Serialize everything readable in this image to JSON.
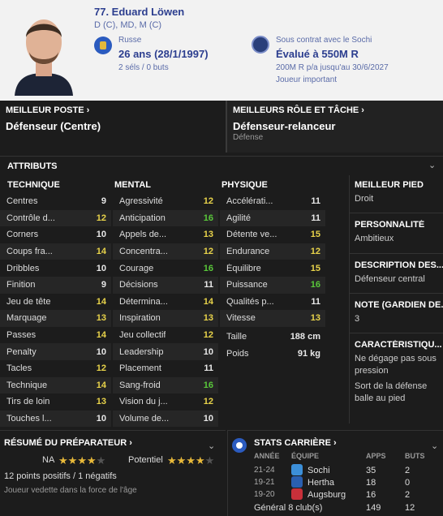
{
  "player": {
    "name": "77. Eduard Löwen",
    "positions": "D (C), MD, M (C)",
    "nationality": "Russe",
    "age": "26 ans (28/1/1997)",
    "caps": "2 séls / 0 buts",
    "contract": "Sous contrat avec le Sochi",
    "value": "Évalué à 550M R",
    "wage": "200M R p/a jusqu'au 30/6/2027",
    "status": "Joueur important"
  },
  "best_position": {
    "title": "MEILLEUR POSTE ›",
    "value": "Défenseur (Centre)"
  },
  "best_role": {
    "title": "MEILLEURS RÔLE ET TÂCHE ›",
    "value": "Défenseur-relanceur",
    "duty": "Défense"
  },
  "attributes": {
    "title": "ATTRIBUTS",
    "technique": {
      "header": "TECHNIQUE",
      "rows": [
        {
          "label": "Centres",
          "value": "9"
        },
        {
          "label": "Contrôle d...",
          "value": "12"
        },
        {
          "label": "Corners",
          "value": "10"
        },
        {
          "label": "Coups fra...",
          "value": "14"
        },
        {
          "label": "Dribbles",
          "value": "10"
        },
        {
          "label": "Finition",
          "value": "9"
        },
        {
          "label": "Jeu de tête",
          "value": "14"
        },
        {
          "label": "Marquage",
          "value": "13"
        },
        {
          "label": "Passes",
          "value": "14"
        },
        {
          "label": "Penalty",
          "value": "10"
        },
        {
          "label": "Tacles",
          "value": "12"
        },
        {
          "label": "Technique",
          "value": "14"
        },
        {
          "label": "Tirs de loin",
          "value": "13"
        },
        {
          "label": "Touches l...",
          "value": "10"
        }
      ]
    },
    "mental": {
      "header": "MENTAL",
      "rows": [
        {
          "label": "Agressivité",
          "value": "12"
        },
        {
          "label": "Anticipation",
          "value": "16"
        },
        {
          "label": "Appels de...",
          "value": "13"
        },
        {
          "label": "Concentra...",
          "value": "12"
        },
        {
          "label": "Courage",
          "value": "16"
        },
        {
          "label": "Décisions",
          "value": "11"
        },
        {
          "label": "Détermina...",
          "value": "14"
        },
        {
          "label": "Inspiration",
          "value": "13"
        },
        {
          "label": "Jeu collectif",
          "value": "12"
        },
        {
          "label": "Leadership",
          "value": "10"
        },
        {
          "label": "Placement",
          "value": "11"
        },
        {
          "label": "Sang-froid",
          "value": "16"
        },
        {
          "label": "Vision du j...",
          "value": "12"
        },
        {
          "label": "Volume de...",
          "value": "10"
        }
      ]
    },
    "physique": {
      "header": "PHYSIQUE",
      "rows": [
        {
          "label": "Accélérati...",
          "value": "11"
        },
        {
          "label": "Agilité",
          "value": "11"
        },
        {
          "label": "Détente ve...",
          "value": "15"
        },
        {
          "label": "Endurance",
          "value": "12"
        },
        {
          "label": "Équilibre",
          "value": "15"
        },
        {
          "label": "Puissance",
          "value": "16"
        },
        {
          "label": "Qualités p...",
          "value": "11"
        },
        {
          "label": "Vitesse",
          "value": "13"
        }
      ],
      "height_label": "Taille",
      "height": "188 cm",
      "weight_label": "Poids",
      "weight": "91 kg"
    }
  },
  "side": {
    "foot_t": "MEILLEUR PIED",
    "foot": "Droit",
    "pers_t": "PERSONNALITÉ",
    "pers": "Ambitieux",
    "desc_t": "DESCRIPTION DES...",
    "desc": "Défenseur central",
    "note_t": "NOTE (GARDIEN DE...",
    "note": "3",
    "car_t": "CARACTÉRISTIQU...",
    "car1": "Ne dégage pas sous pression",
    "car2": "Sort de la défense balle au pied"
  },
  "coach": {
    "title": "RÉSUMÉ DU PRÉPARATEUR ›",
    "na_label": "NA",
    "na_stars": 4,
    "pot_label": "Potentiel",
    "pot_stars": 4,
    "points": "12 points positifs / 1 négatifs",
    "summary": "Joueur vedette dans la force de l'âge"
  },
  "career": {
    "title": "STATS CARRIÈRE ›",
    "headers": {
      "year": "ANNÉE",
      "team": "ÉQUIPE",
      "apps": "APPS",
      "goals": "BUTS"
    },
    "rows": [
      {
        "year": "21-24",
        "team": "Sochi",
        "apps": "35",
        "goals": "2",
        "color": "#3c8fd8"
      },
      {
        "year": "19-21",
        "team": "Hertha",
        "apps": "18",
        "goals": "0",
        "color": "#2a5fb0"
      },
      {
        "year": "19-20",
        "team": "Augsburg",
        "apps": "16",
        "goals": "2",
        "color": "#c8303a"
      }
    ],
    "total": {
      "label": "Général 8 club(s)",
      "apps": "149",
      "goals": "12"
    }
  }
}
